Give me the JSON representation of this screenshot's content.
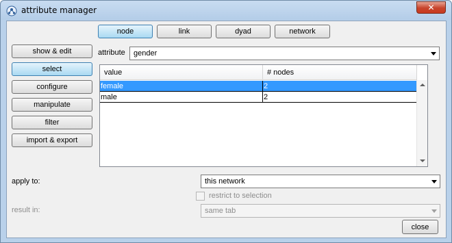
{
  "window": {
    "title": "attribute manager",
    "close_glyph": "✕"
  },
  "top_tabs": [
    {
      "label": "node",
      "selected": true
    },
    {
      "label": "link",
      "selected": false
    },
    {
      "label": "dyad",
      "selected": false
    },
    {
      "label": "network",
      "selected": false
    }
  ],
  "sidebar": [
    {
      "label": "show & edit",
      "selected": false
    },
    {
      "label": "select",
      "selected": true
    },
    {
      "label": "configure",
      "selected": false
    },
    {
      "label": "manipulate",
      "selected": false
    },
    {
      "label": "filter",
      "selected": false
    },
    {
      "label": "import & export",
      "selected": false
    }
  ],
  "attribute": {
    "label": "attribute",
    "value": "gender"
  },
  "table": {
    "headers": [
      "value",
      "# nodes"
    ],
    "rows": [
      {
        "value": "female",
        "count": "2",
        "selected": true
      },
      {
        "value": "male",
        "count": "2",
        "selected": false
      }
    ]
  },
  "apply_to": {
    "label": "apply to:",
    "value": "this network"
  },
  "restrict": {
    "label": "restrict to selection",
    "checked": false,
    "enabled": false
  },
  "result_in": {
    "label": "result in:",
    "value": "same tab",
    "enabled": false
  },
  "close_button": {
    "label": "close"
  },
  "colors": {
    "selection": "#3399ff",
    "title_bg": "#b9d1ea",
    "close_red": "#c7442c"
  }
}
